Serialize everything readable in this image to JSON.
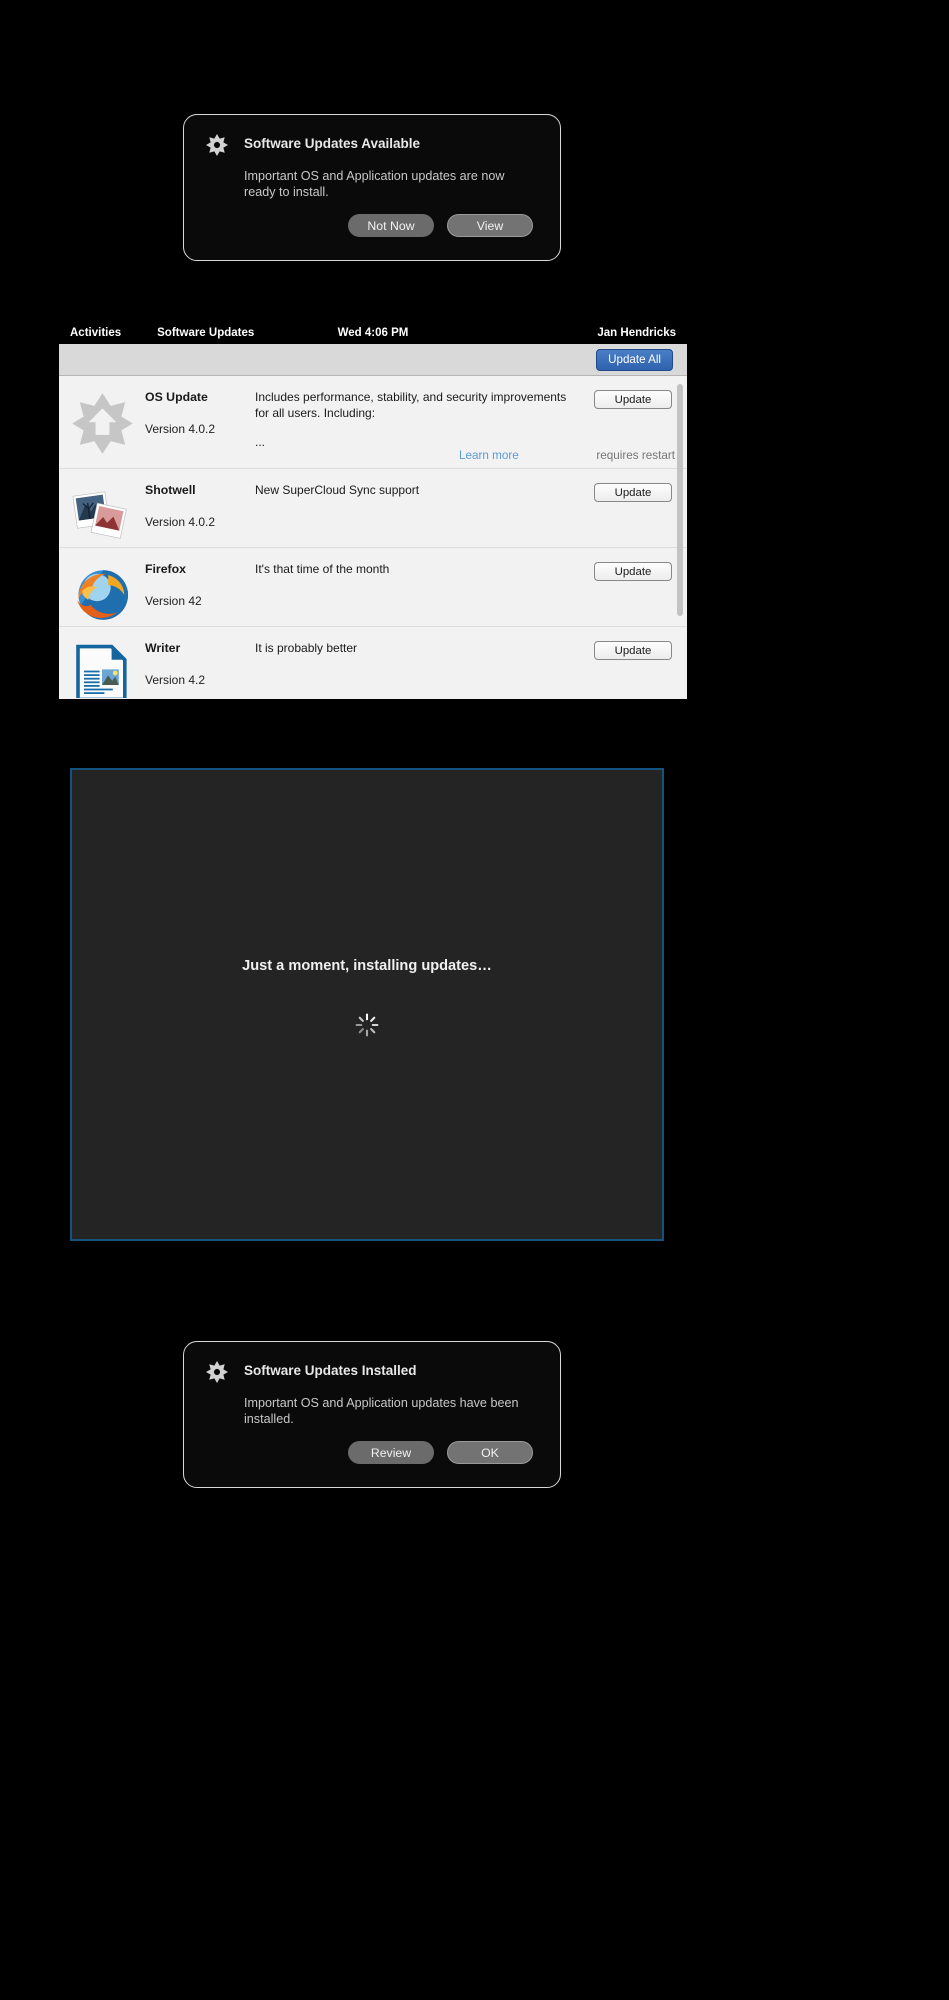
{
  "notification_available": {
    "title": "Software Updates Available",
    "body": "Important OS and Application updates are now ready to install.",
    "buttons": {
      "secondary": "Not Now",
      "primary": "View"
    },
    "icon": "starburst-update-icon"
  },
  "updates_window": {
    "topbar": {
      "activities": "Activities",
      "app_name": "Software Updates",
      "clock": "Wed 4:06 PM",
      "user": "Jan Hendricks"
    },
    "toolbar": {
      "update_all_label": "Update All"
    },
    "rows": [
      {
        "icon": "os-update-starburst-icon",
        "name": "OS Update",
        "version": "Version 4.0.2",
        "description": "Includes performance, stability, and security improvements for all users. Including:",
        "ellipsis": "...",
        "button_label": "Update",
        "learn_more": "Learn more",
        "restart_note": "requires restart"
      },
      {
        "icon": "shotwell-photos-icon",
        "name": "Shotwell",
        "version": "Version 4.0.2",
        "description": "New SuperCloud Sync support",
        "button_label": "Update"
      },
      {
        "icon": "firefox-icon",
        "name": "Firefox",
        "version": "Version 42",
        "description": "It's that time of the month",
        "button_label": "Update"
      },
      {
        "icon": "writer-document-icon",
        "name": "Writer",
        "version": "Version 4.2",
        "description": "It is probably better",
        "button_label": "Update"
      }
    ]
  },
  "installing_panel": {
    "message": "Just a moment, installing updates…",
    "spinner": "loading-spinner-icon"
  },
  "notification_installed": {
    "title": "Software Updates Installed",
    "body": "Important OS and Application updates have been installed.",
    "buttons": {
      "secondary": "Review",
      "primary": "OK"
    },
    "icon": "starburst-update-icon"
  },
  "colors": {
    "background": "#000000",
    "accent_blue": "#2f62ae",
    "link_blue": "#5a9bd8",
    "panel_border_blue": "#15537f",
    "window_bg": "#f2f2f2",
    "toolbar_bg": "#d9d9d9"
  }
}
